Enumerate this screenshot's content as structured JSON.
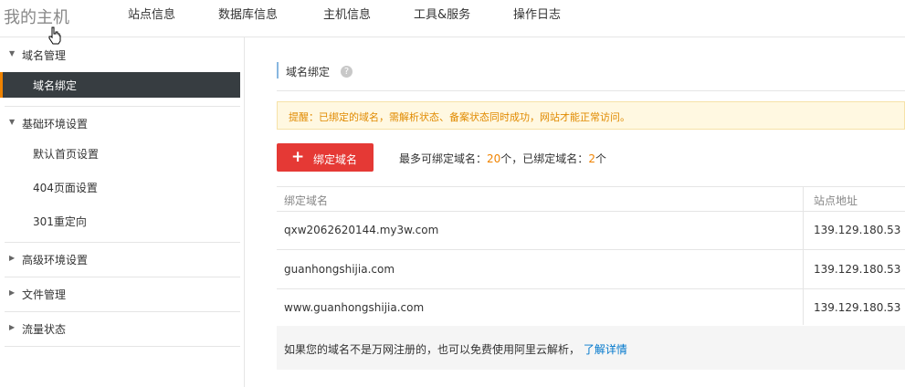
{
  "header": {
    "brand": "我的主机",
    "nav": [
      "站点信息",
      "数据库信息",
      "主机信息",
      "工具&服务",
      "操作日志"
    ]
  },
  "sidebar": {
    "groups": [
      {
        "label": "域名管理",
        "expanded": true,
        "items": [
          "域名绑定"
        ]
      },
      {
        "label": "基础环境设置",
        "expanded": true,
        "items": [
          "默认首页设置",
          "404页面设置",
          "301重定向"
        ]
      },
      {
        "label": "高级环境设置",
        "expanded": false,
        "items": []
      },
      {
        "label": "文件管理",
        "expanded": false,
        "items": []
      },
      {
        "label": "流量状态",
        "expanded": false,
        "items": []
      }
    ],
    "active_item": "域名绑定"
  },
  "main": {
    "title": "域名绑定",
    "help_icon": "question-circle-icon",
    "notice": "提醒：已绑定的域名，需解析状态、备案状态同时成功，网站才能正常访问。",
    "add_button_label": "绑定域名",
    "quota": {
      "prefix": "最多可绑定域名：",
      "max": "20",
      "middle": "个，已绑定域名：",
      "bound": "2",
      "suffix": "个"
    },
    "table": {
      "columns": [
        "绑定域名",
        "站点地址"
      ],
      "rows": [
        [
          "qxw2062620144.my3w.com",
          "139.129.180.53"
        ],
        [
          "guanhongshijia.com",
          "139.129.180.53"
        ],
        [
          "www.guanhongshijia.com",
          "139.129.180.53"
        ]
      ]
    },
    "footer_text": "如果您的域名不是万网注册的，也可以免费使用阿里云解析，",
    "footer_link": "了解详情"
  },
  "colors": {
    "accent": "#f08300",
    "danger_button": "#e53935",
    "active_sidebar_bg": "#373d41",
    "link": "#0077cc",
    "notice_bg": "#fff8e1"
  }
}
